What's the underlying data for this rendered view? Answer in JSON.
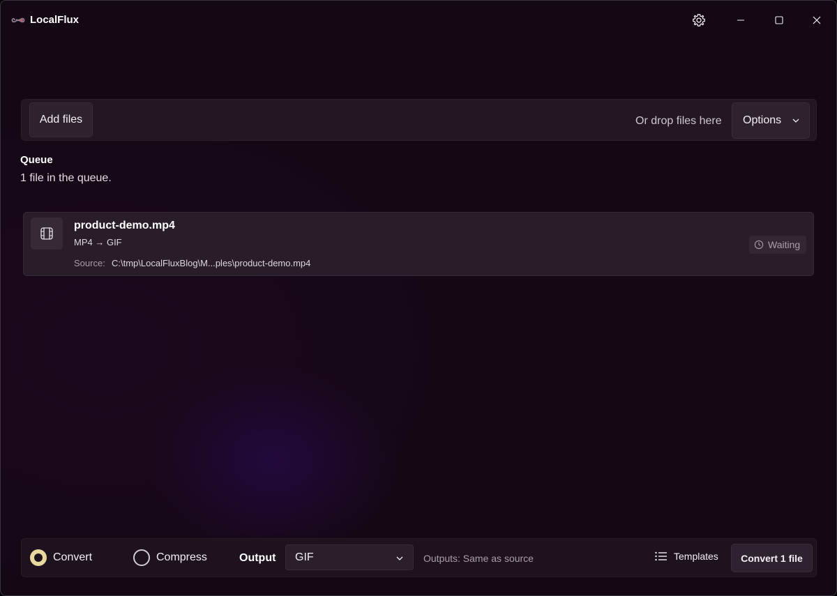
{
  "app": {
    "title": "LocalFlux",
    "logo_icon": "infinity-logo-icon"
  },
  "titlebar": {
    "settings_icon": "gear-icon",
    "minimize_icon": "minimize-icon",
    "maximize_icon": "maximize-icon",
    "close_icon": "close-icon"
  },
  "toolbar": {
    "add_files_label": "Add files",
    "drop_hint": "Or drop files here",
    "options_label": "Options"
  },
  "queue": {
    "title": "Queue",
    "count_text": "1 file in the queue.",
    "items": [
      {
        "file_name": "product-demo.mp4",
        "conversion": "MP4 → GIF",
        "source_label": "Source:",
        "source_path": "C:\\tmp\\LocalFluxBlog\\M...ples\\product-demo.mp4",
        "status": "Waiting",
        "icon": "film-icon",
        "status_icon": "clock-icon"
      }
    ]
  },
  "bottombar": {
    "mode_convert_label": "Convert",
    "mode_compress_label": "Compress",
    "selected_mode": "Convert",
    "output_label": "Output",
    "output_value": "GIF",
    "outputs_hint": "Outputs: Same as source",
    "templates_label": "Templates",
    "convert_button_label": "Convert 1 file"
  },
  "colors": {
    "background": "#140814",
    "accent_radio": "#e9d7a0",
    "panel": "#231723",
    "card": "#2a1d2a"
  }
}
